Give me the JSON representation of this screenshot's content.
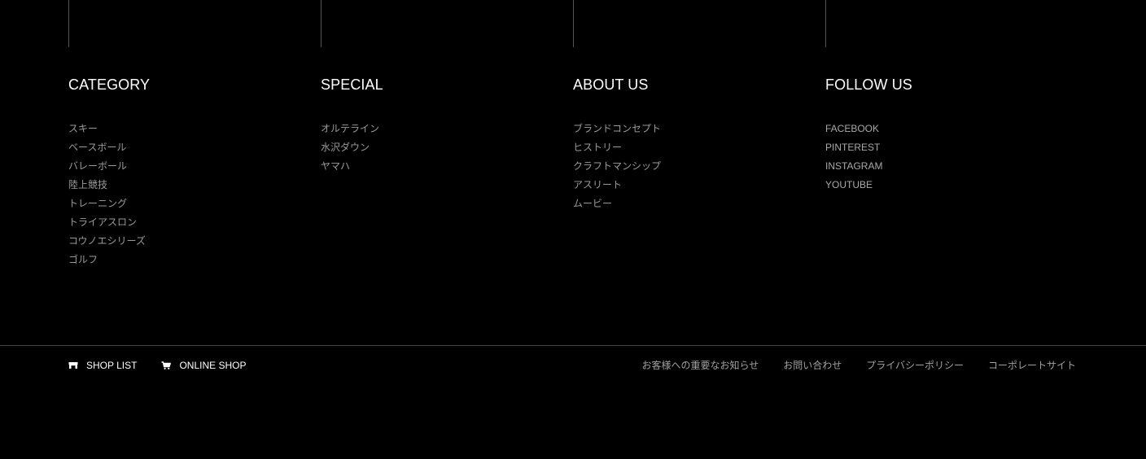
{
  "columns": [
    {
      "title": "CATEGORY",
      "items": [
        "スキー",
        "ベースボール",
        "バレーボール",
        "陸上競技",
        "トレーニング",
        "トライアスロン",
        "コウノエシリーズ",
        "ゴルフ"
      ]
    },
    {
      "title": "SPECIAL",
      "items": [
        "オルテライン",
        "水沢ダウン",
        "ヤマハ"
      ]
    },
    {
      "title": "ABOUT US",
      "items": [
        "ブランドコンセプト",
        "ヒストリー",
        "クラフトマンシップ",
        "アスリート",
        "ムービー"
      ]
    },
    {
      "title": "FOLLOW US",
      "items": [
        "FACEBOOK",
        "PINTEREST",
        "INSTAGRAM",
        "YOUTUBE"
      ]
    }
  ],
  "bottom": {
    "shop_list": {
      "label": "SHOP LIST",
      "icon": "store-icon"
    },
    "online_shop": {
      "label": "ONLINE SHOP",
      "icon": "cart-icon"
    },
    "legal_links": [
      "お客様への重要なお知らせ",
      "お問い合わせ",
      "プライバシーポリシー",
      "コーポレートサイト"
    ]
  },
  "colors": {
    "background": "#000000",
    "heading": "#ffffff",
    "link": "#9a9a9a",
    "divider": "#444444"
  }
}
